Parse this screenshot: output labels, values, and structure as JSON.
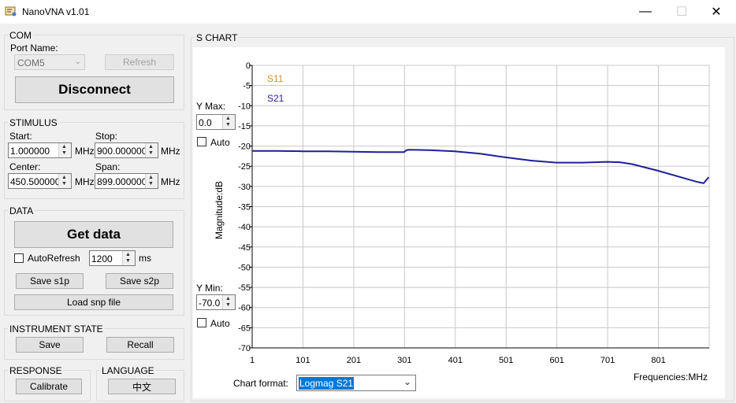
{
  "window": {
    "title": "NanoVNA v1.01",
    "minimize_glyph": "—",
    "maximize_glyph": "☐",
    "close_glyph": "✕"
  },
  "com": {
    "group_label": "COM",
    "port_label": "Port Name:",
    "port_value": "COM5",
    "refresh_label": "Refresh",
    "disconnect_label": "Disconnect"
  },
  "stimulus": {
    "group_label": "STIMULUS",
    "start_label": "Start:",
    "start_value": "1.000000",
    "stop_label": "Stop:",
    "stop_value": "900.000000",
    "center_label": "Center:",
    "center_value": "450.500000",
    "span_label": "Span:",
    "span_value": "899.000000",
    "unit": "MHz"
  },
  "data_section": {
    "group_label": "DATA",
    "get_data_label": "Get data",
    "autorefresh_label": "AutoRefresh",
    "autorefresh_checked": false,
    "interval_value": "1200",
    "interval_unit": "ms",
    "save_s1p_label": "Save s1p",
    "save_s2p_label": "Save s2p",
    "load_snp_label": "Load snp file"
  },
  "instrument_state": {
    "group_label": "INSTRUMENT STATE",
    "save_label": "Save",
    "recall_label": "Recall"
  },
  "response": {
    "group_label": "RESPONSE",
    "calibrate_label": "Calibrate"
  },
  "language": {
    "group_label": "LANGUAGE",
    "lang_button_label": "中文"
  },
  "s_chart": {
    "group_label": "S CHART",
    "y_max_label": "Y Max:",
    "y_max_value": "0.0",
    "y_max_auto_label": "Auto",
    "y_min_label": "Y Min:",
    "y_min_value": "-70.0",
    "y_min_auto_label": "Auto",
    "chart_format_label": "Chart format:",
    "chart_format_value": "Logmag S21"
  },
  "chart_data": {
    "type": "line",
    "xlabel": "Frequencies:MHz",
    "ylabel": "Magnitude:dB",
    "xlim": [
      1,
      901
    ],
    "ylim": [
      -70,
      0
    ],
    "x_ticks": [
      "1",
      "101",
      "201",
      "301",
      "401",
      "501",
      "601",
      "701",
      "801"
    ],
    "y_ticks": [
      "0",
      "-5",
      "-10",
      "-15",
      "-20",
      "-25",
      "-30",
      "-35",
      "-40",
      "-45",
      "-50",
      "-55",
      "-60",
      "-65",
      "-70"
    ],
    "grid": true,
    "legend_position": "top-left",
    "series": [
      {
        "name": "S11",
        "color": "#d4912c",
        "x": [],
        "y": []
      },
      {
        "name": "S21",
        "color": "#1f1f9a",
        "x": [
          1,
          50,
          100,
          150,
          200,
          250,
          300,
          305,
          310,
          350,
          400,
          450,
          500,
          550,
          600,
          650,
          700,
          725,
          750,
          800,
          850,
          875,
          890,
          900
        ],
        "y": [
          -21.2,
          -21.2,
          -21.3,
          -21.3,
          -21.4,
          -21.5,
          -21.5,
          -21.0,
          -20.9,
          -21.0,
          -21.3,
          -21.9,
          -22.8,
          -23.6,
          -24.1,
          -24.1,
          -23.9,
          -24.0,
          -24.5,
          -26.1,
          -27.9,
          -28.8,
          -29.2,
          -27.7
        ]
      }
    ]
  }
}
